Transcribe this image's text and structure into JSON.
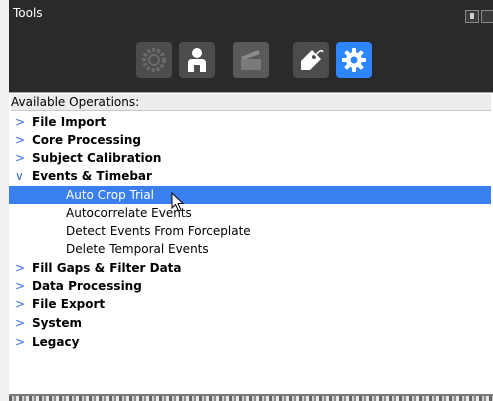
{
  "panel": {
    "title": "Tools"
  },
  "toolbar": {
    "buttons": [
      {
        "icon": "gear-outline-icon",
        "state": "disabled"
      },
      {
        "icon": "person-icon",
        "state": "normal"
      },
      {
        "icon": "clapperboard-icon",
        "state": "disabled"
      },
      {
        "icon": "tag-icon",
        "state": "normal"
      },
      {
        "icon": "gear-icon",
        "state": "active"
      }
    ],
    "active_color": "#2e86ff"
  },
  "list": {
    "header": "Available Operations:",
    "items": [
      {
        "label": "File Import",
        "expanded": false,
        "arrow": ">"
      },
      {
        "label": "Core Processing",
        "expanded": false,
        "arrow": ">"
      },
      {
        "label": "Subject Calibration",
        "expanded": false,
        "arrow": ">"
      },
      {
        "label": "Events & Timebar",
        "expanded": true,
        "arrow": "∨"
      },
      {
        "label": "Auto Crop Trial",
        "child": true,
        "selected": true
      },
      {
        "label": "Autocorrelate Events",
        "child": true
      },
      {
        "label": "Detect Events From Forceplate",
        "child": true
      },
      {
        "label": "Delete Temporal Events",
        "child": true
      },
      {
        "label": "Fill Gaps & Filter Data",
        "expanded": false,
        "arrow": ">"
      },
      {
        "label": "Data Processing",
        "expanded": false,
        "arrow": ">"
      },
      {
        "label": "File Export",
        "expanded": false,
        "arrow": ">"
      },
      {
        "label": "System",
        "expanded": false,
        "arrow": ">"
      },
      {
        "label": "Legacy",
        "expanded": false,
        "arrow": ">"
      }
    ],
    "selection_color": "#3a7ff0"
  }
}
